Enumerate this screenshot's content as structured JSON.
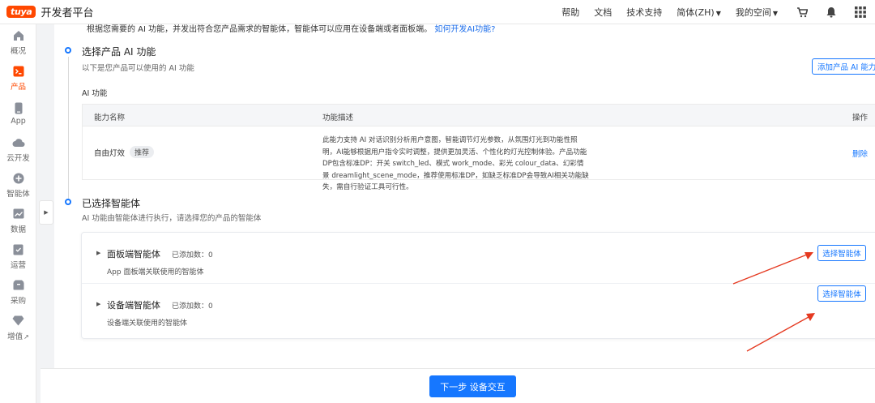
{
  "header": {
    "logo_badge": "tuya",
    "logo_text": "开发者平台",
    "nav": {
      "help": "帮助",
      "docs": "文档",
      "support": "技术支持",
      "language": "简体(ZH)",
      "space": "我的空间"
    },
    "icons": [
      "cart-icon",
      "bell-icon",
      "grid-icon"
    ]
  },
  "sidebar": {
    "items": [
      {
        "label": "概况",
        "icon": "home-icon",
        "active": false
      },
      {
        "label": "产品",
        "icon": "terminal-icon",
        "active": true
      },
      {
        "label": "App",
        "icon": "phone-icon",
        "active": false
      },
      {
        "label": "云开发",
        "icon": "cloud-icon",
        "active": false
      },
      {
        "label": "智能体",
        "icon": "agent-icon",
        "active": false
      },
      {
        "label": "数据",
        "icon": "chart-icon",
        "active": false
      },
      {
        "label": "运营",
        "icon": "operation-icon",
        "active": false
      },
      {
        "label": "采购",
        "icon": "box-icon",
        "active": false
      },
      {
        "label": "增值",
        "icon": "diamond-icon",
        "active": false
      }
    ],
    "extra_arrow": "↗"
  },
  "main": {
    "intro_text": "根据您需要的 AI 功能，并发出符合您产品需求的智能体，智能体可以应用在设备端或者面板端。",
    "intro_link": "如何开发AI功能?",
    "section_ai": {
      "title": "选择产品 AI 功能",
      "subtitle": "以下是您产品可以使用的 AI 功能",
      "add_button": "添加产品 AI 能力",
      "table_label": "AI 功能",
      "columns": {
        "name": "能力名称",
        "desc": "功能描述",
        "op": "操作"
      },
      "rows": [
        {
          "name": "自由灯效",
          "tag": "推荐",
          "desc": "此能力支持 AI 对话识别分析用户意图，智能调节灯光参数，从氛围灯光到功能性照明，AI能够根据用户指令实时调整，提供更加灵活、个性化的灯光控制体验。产品功能DP包含标准DP：开关 switch_led、模式 work_mode、彩光 colour_data、幻彩情景 dreamlight_scene_mode，推荐使用标准DP，如缺乏标准DP会导致AI相关功能缺失，需自行验证工具可行性。",
          "op": "删除"
        }
      ]
    },
    "section_agents": {
      "title": "已选择智能体",
      "subtitle": "AI 功能由智能体进行执行，请选择您的产品的智能体",
      "rows": [
        {
          "title": "面板端智能体",
          "count": "已添加数：0",
          "sub": "App 面板端关联使用的智能体",
          "button": "选择智能体"
        },
        {
          "title": "设备端智能体",
          "count": "已添加数：0",
          "sub": "设备端关联使用的智能体",
          "button": "选择智能体"
        }
      ]
    }
  },
  "footer": {
    "next_button": "下一步 设备交互"
  },
  "colors": {
    "brand": "#ff4800",
    "primary": "#1677ff",
    "annotation_arrow": "#e53920"
  }
}
